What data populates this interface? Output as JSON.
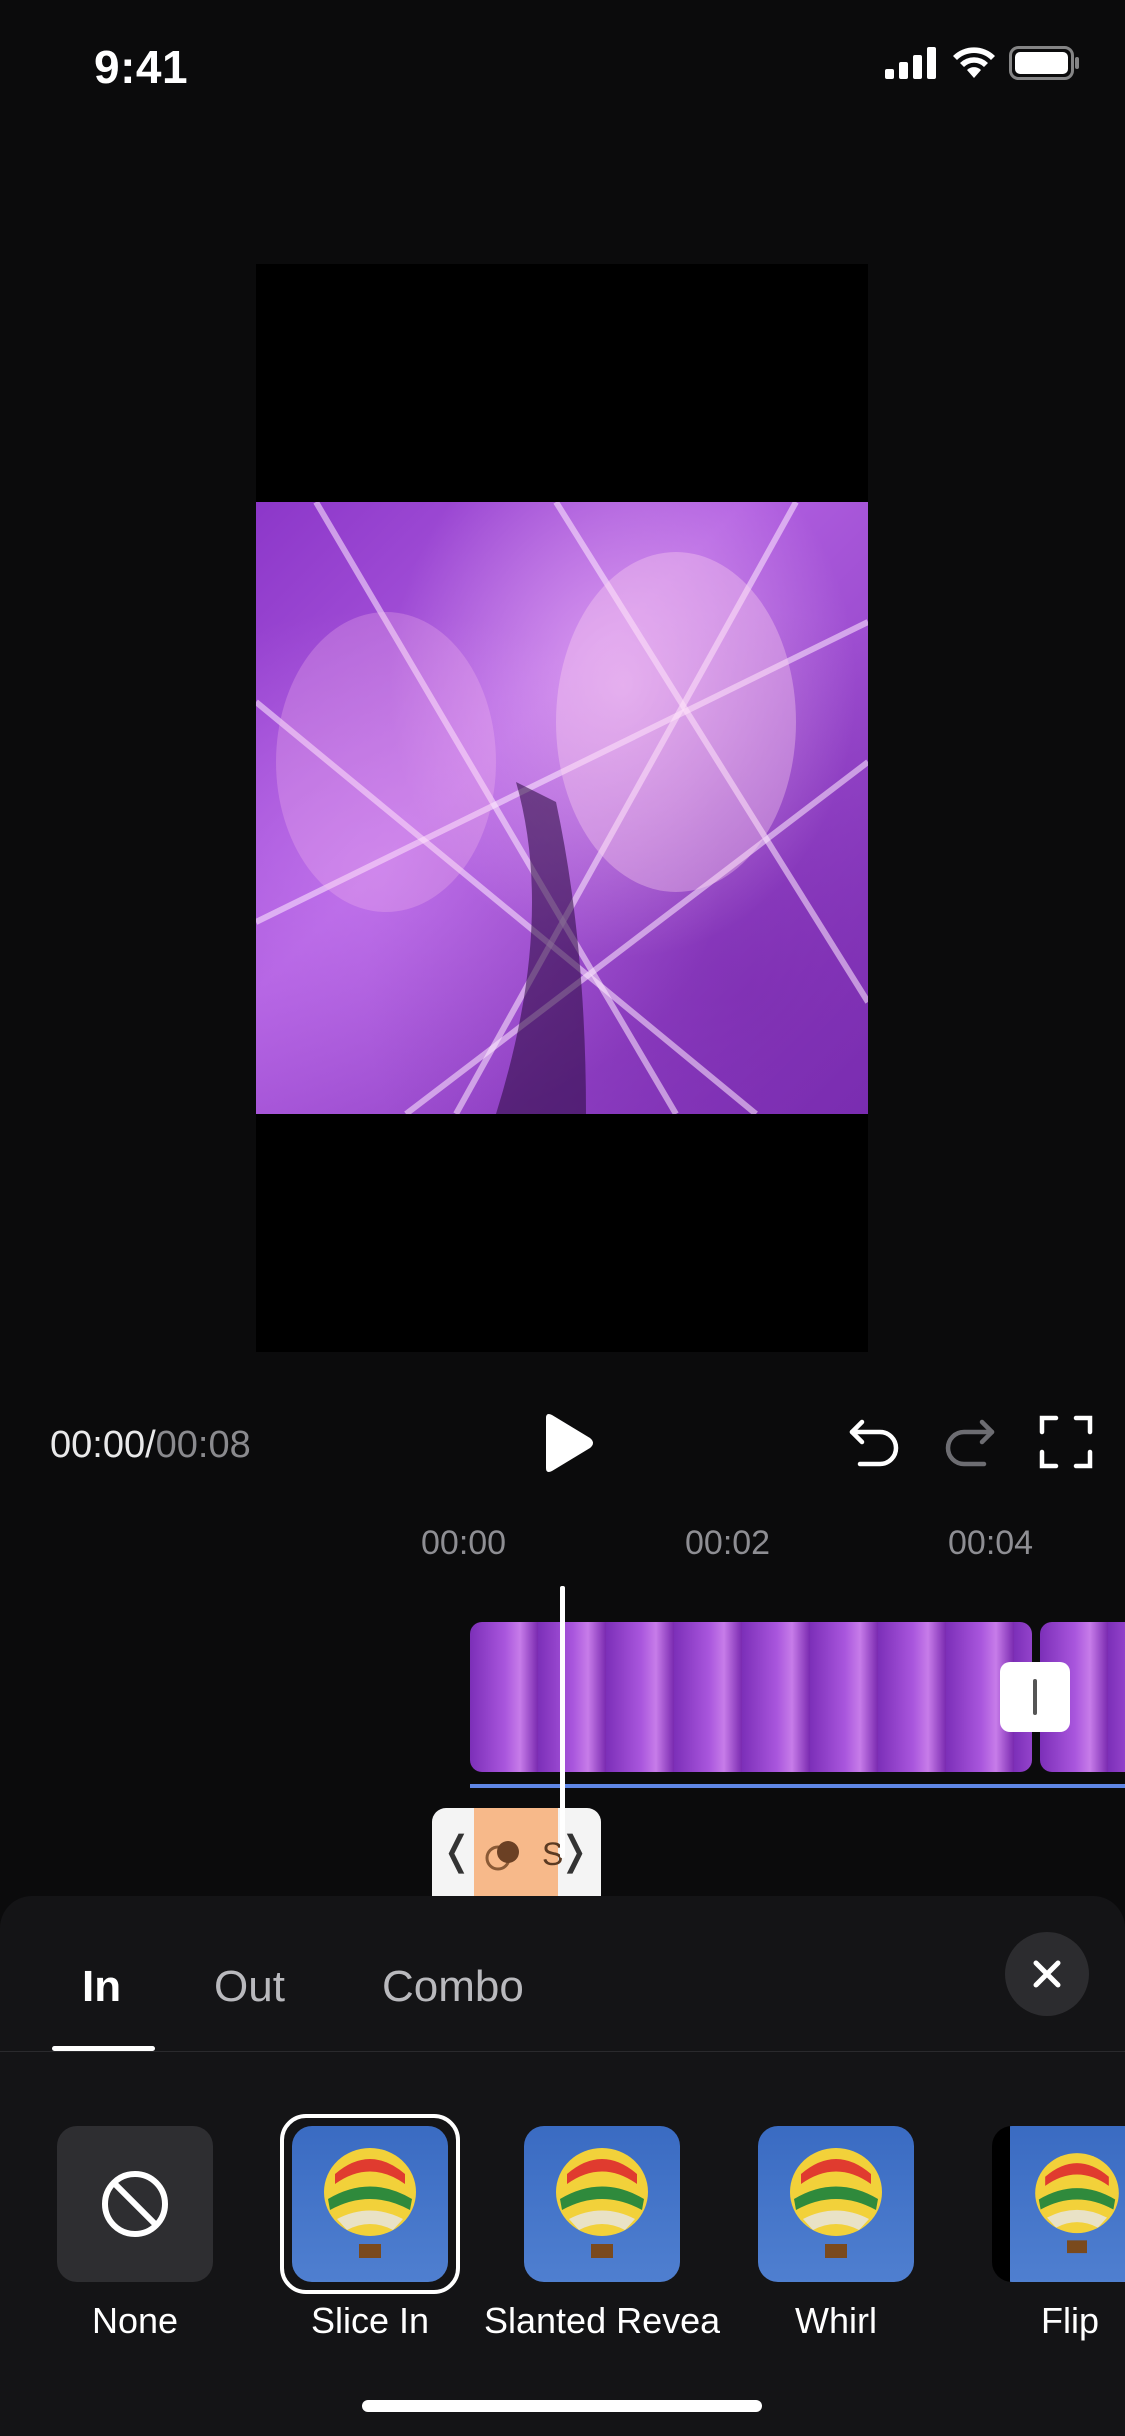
{
  "status_bar": {
    "time": "9:41"
  },
  "player": {
    "time_current": "00:00",
    "time_separator": "/",
    "time_total": "00:08"
  },
  "ruler": {
    "labels": [
      "00:00",
      "00:02",
      "00:04"
    ]
  },
  "animation_clip": {
    "label": "S"
  },
  "tabs": [
    {
      "label": "In",
      "active": true
    },
    {
      "label": "Out",
      "active": false
    },
    {
      "label": "Combo",
      "active": false
    }
  ],
  "effects": [
    {
      "label": "None",
      "icon": "none-icon"
    },
    {
      "label": "Slice In",
      "icon": "balloon-thumbnail",
      "selected": true
    },
    {
      "label": "Slanted Reveal",
      "icon": "balloon-thumbnail"
    },
    {
      "label": "Whirl",
      "icon": "balloon-thumbnail"
    },
    {
      "label": "Flip",
      "icon": "balloon-thumbnail"
    }
  ],
  "colors": {
    "background": "#0b0b0c",
    "sheet": "#141416",
    "accent_track": "#5f86e6",
    "clip_highlight": "#f7b98a"
  }
}
